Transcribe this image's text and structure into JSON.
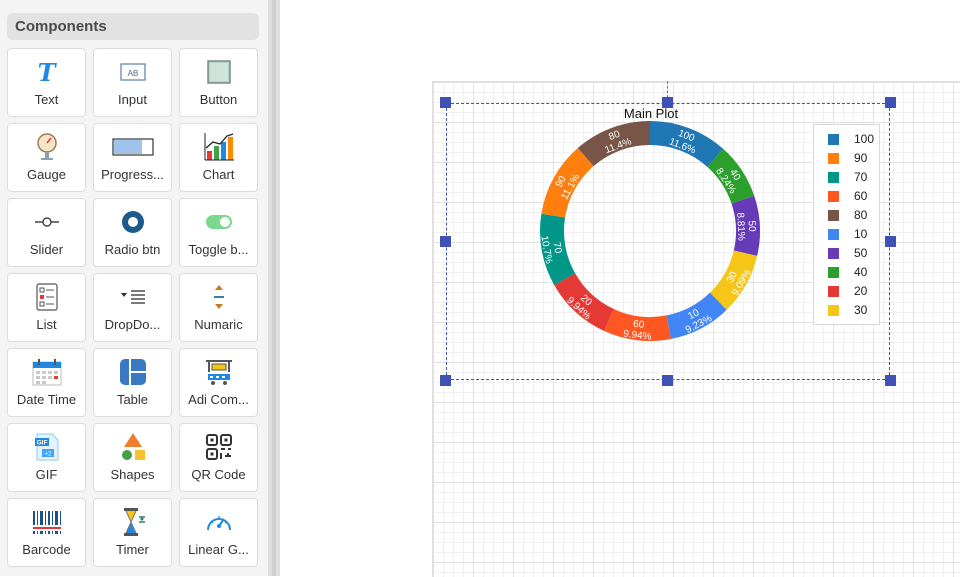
{
  "panel": {
    "title": "Components",
    "items": [
      {
        "label": "Text",
        "icon": "text-icon"
      },
      {
        "label": "Input",
        "icon": "input-icon"
      },
      {
        "label": "Button",
        "icon": "button-icon"
      },
      {
        "label": "Gauge",
        "icon": "gauge-icon"
      },
      {
        "label": "Progress...",
        "icon": "progress-icon"
      },
      {
        "label": "Chart",
        "icon": "chart-icon"
      },
      {
        "label": "Slider",
        "icon": "slider-icon"
      },
      {
        "label": "Radio btn",
        "icon": "radio-icon"
      },
      {
        "label": "Toggle b...",
        "icon": "toggle-icon"
      },
      {
        "label": "List",
        "icon": "list-icon"
      },
      {
        "label": "DropDo...",
        "icon": "dropdown-icon"
      },
      {
        "label": "Numaric",
        "icon": "numeric-icon"
      },
      {
        "label": "Date Time",
        "icon": "calendar-icon"
      },
      {
        "label": "Table",
        "icon": "table-icon"
      },
      {
        "label": "Adi Com...",
        "icon": "component-icon"
      },
      {
        "label": "GIF",
        "icon": "gif-icon"
      },
      {
        "label": "Shapes",
        "icon": "shapes-icon"
      },
      {
        "label": "QR Code",
        "icon": "qr-code-icon"
      },
      {
        "label": "Barcode",
        "icon": "barcode-icon"
      },
      {
        "label": "Timer",
        "icon": "timer-icon"
      },
      {
        "label": "Linear G...",
        "icon": "linear-gauge-icon"
      }
    ]
  },
  "chart": {
    "title": "Main Plot",
    "accent": "#3f51b5"
  },
  "chart_data": {
    "type": "pie",
    "title": "Main Plot",
    "donut": true,
    "legend_position": "right",
    "slices": [
      {
        "label": "100",
        "value": 100,
        "percent": "11.6%",
        "color": "#1f77b4"
      },
      {
        "label": "40",
        "value": 40,
        "percent": "8.24%",
        "color": "#2ca02c"
      },
      {
        "label": "50",
        "value": 50,
        "percent": "8.81%",
        "color": "#673ab7"
      },
      {
        "label": "30",
        "value": 30,
        "percent": "9.09%",
        "color": "#f5c518"
      },
      {
        "label": "10",
        "value": 10,
        "percent": "9.23%",
        "color": "#4285f4"
      },
      {
        "label": "60",
        "value": 60,
        "percent": "9.94%",
        "color": "#ff5722"
      },
      {
        "label": "20",
        "value": 20,
        "percent": "9.94%",
        "color": "#e53935"
      },
      {
        "label": "70",
        "value": 70,
        "percent": "10.7%",
        "color": "#009688"
      },
      {
        "label": "90",
        "value": 90,
        "percent": "11.1%",
        "color": "#ff7f0e"
      },
      {
        "label": "80",
        "value": 80,
        "percent": "11.4%",
        "color": "#795548"
      }
    ],
    "legend": [
      {
        "label": "100",
        "color": "#1f77b4"
      },
      {
        "label": "90",
        "color": "#ff7f0e"
      },
      {
        "label": "70",
        "color": "#009688"
      },
      {
        "label": "60",
        "color": "#ff5722"
      },
      {
        "label": "80",
        "color": "#795548"
      },
      {
        "label": "10",
        "color": "#4285f4"
      },
      {
        "label": "50",
        "color": "#673ab7"
      },
      {
        "label": "40",
        "color": "#2ca02c"
      },
      {
        "label": "20",
        "color": "#e53935"
      },
      {
        "label": "30",
        "color": "#f5c518"
      }
    ]
  }
}
